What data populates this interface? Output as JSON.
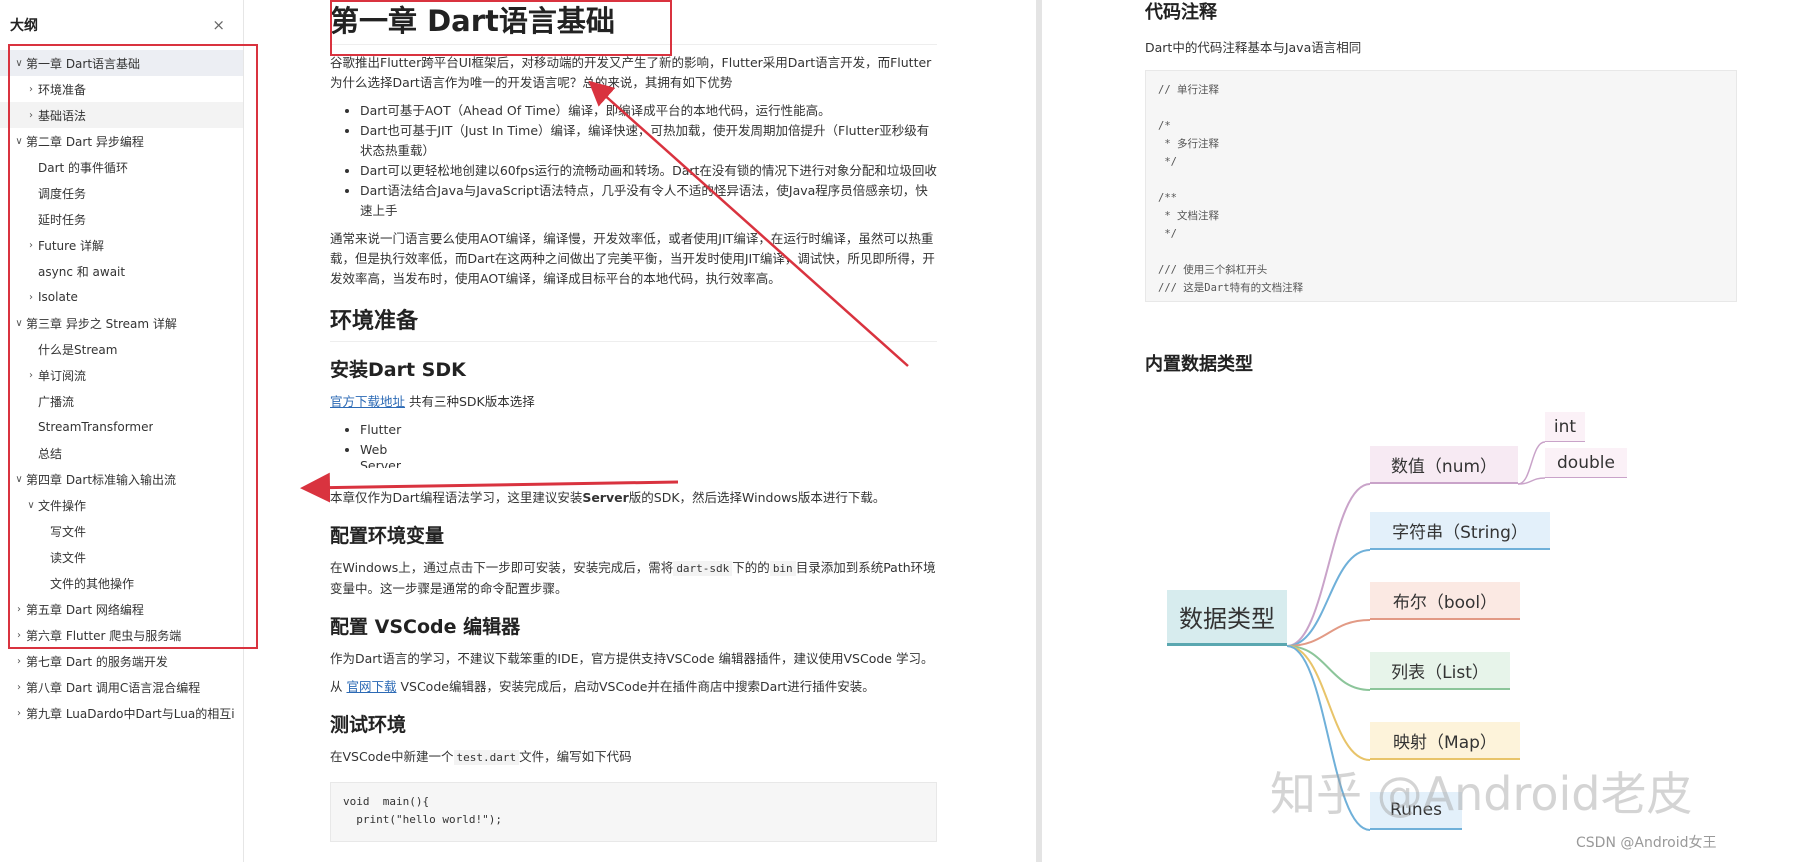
{
  "sidebar": {
    "title": "大纲",
    "close_icon": "×",
    "items": [
      {
        "label": "第一章 Dart语言基础",
        "level": 0,
        "arrow": "down",
        "state": "active"
      },
      {
        "label": "环境准备",
        "level": 1,
        "arrow": "right",
        "state": ""
      },
      {
        "label": "基础语法",
        "level": 1,
        "arrow": "right",
        "state": "shaded"
      },
      {
        "label": "第二章 Dart 异步编程",
        "level": 0,
        "arrow": "down",
        "state": ""
      },
      {
        "label": "Dart 的事件循环",
        "level": 1,
        "arrow": "none",
        "state": ""
      },
      {
        "label": "调度任务",
        "level": 1,
        "arrow": "none",
        "state": ""
      },
      {
        "label": "延时任务",
        "level": 1,
        "arrow": "none",
        "state": ""
      },
      {
        "label": "Future 详解",
        "level": 1,
        "arrow": "right",
        "state": ""
      },
      {
        "label": "async 和 await",
        "level": 1,
        "arrow": "none",
        "state": ""
      },
      {
        "label": "Isolate",
        "level": 1,
        "arrow": "right",
        "state": ""
      },
      {
        "label": "第三章 异步之 Stream 详解",
        "level": 0,
        "arrow": "down",
        "state": ""
      },
      {
        "label": "什么是Stream",
        "level": 1,
        "arrow": "none",
        "state": ""
      },
      {
        "label": "单订阅流",
        "level": 1,
        "arrow": "right",
        "state": ""
      },
      {
        "label": "广播流",
        "level": 1,
        "arrow": "none",
        "state": ""
      },
      {
        "label": "StreamTransformer",
        "level": 1,
        "arrow": "none",
        "state": ""
      },
      {
        "label": "总结",
        "level": 1,
        "arrow": "none",
        "state": ""
      },
      {
        "label": "第四章 Dart标准输入输出流",
        "level": 0,
        "arrow": "down",
        "state": ""
      },
      {
        "label": "文件操作",
        "level": 1,
        "arrow": "down",
        "state": ""
      },
      {
        "label": "写文件",
        "level": 2,
        "arrow": "none",
        "state": ""
      },
      {
        "label": "读文件",
        "level": 2,
        "arrow": "none",
        "state": ""
      },
      {
        "label": "文件的其他操作",
        "level": 2,
        "arrow": "none",
        "state": ""
      },
      {
        "label": "第五章 Dart 网络编程",
        "level": 0,
        "arrow": "right",
        "state": ""
      },
      {
        "label": "第六章 Flutter 爬虫与服务端",
        "level": 0,
        "arrow": "right",
        "state": ""
      },
      {
        "label": "第七章 Dart 的服务端开发",
        "level": 0,
        "arrow": "right",
        "state": ""
      },
      {
        "label": "第八章 Dart 调用C语言混合编程",
        "level": 0,
        "arrow": "right",
        "state": ""
      },
      {
        "label": "第九章 LuaDardo中Dart与Lua的相互i",
        "level": 0,
        "arrow": "right",
        "state": ""
      }
    ]
  },
  "doc_left": {
    "h1": "第一章 Dart语言基础",
    "intro": "谷歌推出Flutter跨平台UI框架后，对移动端的开发又产生了新的影响，Flutter采用Dart语言开发，而Flutter为什么选择Dart语言作为唯一的开发语言呢？总的来说，其拥有如下优势",
    "bullets": [
      "Dart可基于AOT（Ahead Of Time）编译，即编译成平台的本地代码，运行性能高。",
      "Dart也可基于JIT（Just In Time）编译，编译快速，可热加载，使开发周期加倍提升（Flutter亚秒级有状态热重载）",
      "Dart可以更轻松地创建以60fps运行的流畅动画和转场。Dart在没有锁的情况下进行对象分配和垃圾回收",
      "Dart语法结合Java与JavaScript语法特点，几乎没有令人不适的怪异语法，使Java程序员倍感亲切，快速上手"
    ],
    "para2": "通常来说一门语言要么使用AOT编译，编译慢，开发效率低，或者使用JIT编译，在运行时编译，虽然可以热重载，但是执行效率低，而Dart在这两种之间做出了完美平衡，当开发时使用JIT编译，调试快，所见即所得，开发效率高，当发布时，使用AOT编译，编译成目标平台的本地代码，执行效率高。",
    "h2_env": "环境准备",
    "h3_sdk": "安装Dart SDK",
    "sdk_link": "官方下载地址",
    "sdk_text": " 共有三种SDK版本选择",
    "sdk_versions": [
      "Flutter",
      "Web",
      "Server"
    ],
    "sdk_note_a": "本章仅作为Dart编程语法学习，这里建议安装",
    "sdk_note_bold": "Server",
    "sdk_note_b": "版的SDK，然后选择Windows版本进行下载。",
    "h3_envvar": "配置环境变量",
    "env_a": "在Windows上，通过点击下一步即可安装，安装完成后，需将",
    "env_code1": "dart-sdk",
    "env_b": "下的的",
    "env_code2": "bin",
    "env_c": "目录添加到系统Path环境变量中。这一步骤是通常的命令配置步骤。",
    "h3_vscode": "配置 VSCode 编辑器",
    "vscode_p1": "作为Dart语言的学习，不建议下载笨重的IDE，官方提供支持VSCode 编辑器插件，建议使用VSCode 学习。",
    "vscode_p2_a": "从 ",
    "vscode_link": "官网下载",
    "vscode_p2_b": " VSCode编辑器，安装完成后，启动VSCode并在插件商店中搜索Dart进行插件安装。",
    "h3_test": "测试环境",
    "test_a": "在VSCode中新建一个",
    "test_code": "test.dart",
    "test_b": "文件，编写如下代码",
    "code_lines": [
      "void  main(){",
      "  print(\"hello world!\");"
    ]
  },
  "doc_right": {
    "h3_comment": "代码注释",
    "comment_desc": "Dart中的代码注释基本与Java语言相同",
    "comment_lines": [
      "// 单行注释",
      "",
      "/*",
      " * 多行注释",
      " */",
      "",
      "/**",
      " * 文档注释",
      " */",
      "",
      "/// 使用三个斜杠开头",
      "/// 这是Dart特有的文档注释"
    ],
    "h3_types": "内置数据类型"
  },
  "mindmap": {
    "root": "数据类型",
    "branches": [
      {
        "label": "数值（num）",
        "color": "#c9a3c9",
        "fill": "#f7eaf3"
      },
      {
        "label": "字符串（String）",
        "color": "#6fb0d9",
        "fill": "#e3f0fa"
      },
      {
        "label": "布尔（bool）",
        "color": "#e29a85",
        "fill": "#fbe9e3"
      },
      {
        "label": "列表（List）",
        "color": "#8cc59a",
        "fill": "#e7f4ea"
      },
      {
        "label": "映射（Map）",
        "color": "#e8c46a",
        "fill": "#fdf3da"
      },
      {
        "label": "Runes",
        "color": "#6fb0d9",
        "fill": "#e3f0fa"
      }
    ],
    "num_children": [
      "int",
      "double"
    ],
    "root_color": "#5aa7b0",
    "root_fill": "#d7ecee"
  },
  "watermarks": {
    "zhihu": "知乎 @Android老皮",
    "csdn": "CSDN @Android女王"
  },
  "accent": "#d9333f"
}
